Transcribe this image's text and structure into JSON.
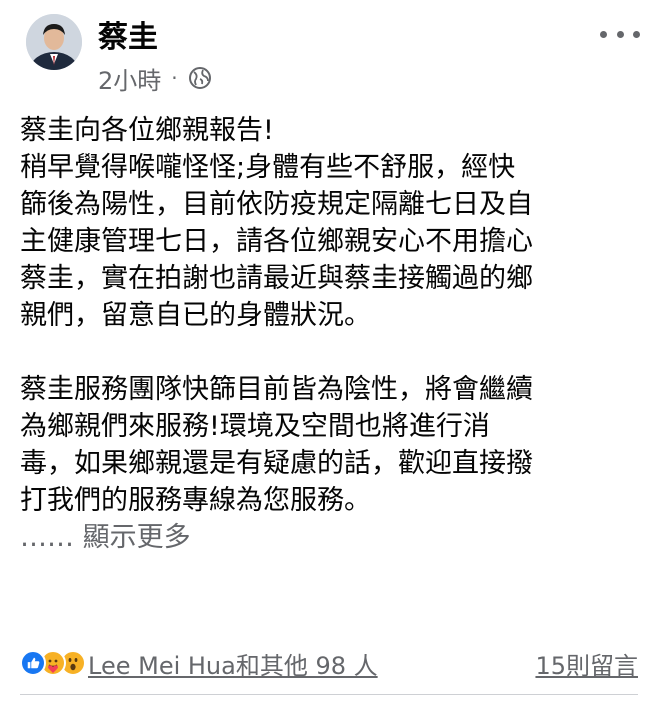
{
  "post": {
    "author": "蔡圭",
    "time": "2小時",
    "separator": "·",
    "lines": [
      "蔡圭向各位鄉親報告!",
      "稍早覺得喉嚨怪怪;身體有些不舒服，經快",
      "篩後為陽性，目前依防疫規定隔離七日及自",
      "主健康管理七日，請各位鄉親安心不用擔心",
      "蔡圭，實在拍謝也請最近與蔡圭接觸過的鄉",
      "親們，留意自已的身體狀況。",
      "",
      "蔡圭服務團隊快篩目前皆為陰性，將會繼續",
      "為鄉親們來服務!環境及空間也將進行消",
      "毒，如果鄉親還是有疑慮的話，歡迎直接撥",
      "打我們的服務專線為您服務。"
    ],
    "see_more": "…… 顯示更多"
  },
  "reactions": {
    "icons": [
      "like-icon",
      "care-icon",
      "wow-icon"
    ],
    "summary": "Lee Mei Hua和其他 98 人",
    "comments": "15則留言"
  },
  "colors": {
    "text": "#050505",
    "secondary": "#65676b",
    "like_blue": "#1877f2",
    "reaction_yellow": "#f7b125"
  }
}
